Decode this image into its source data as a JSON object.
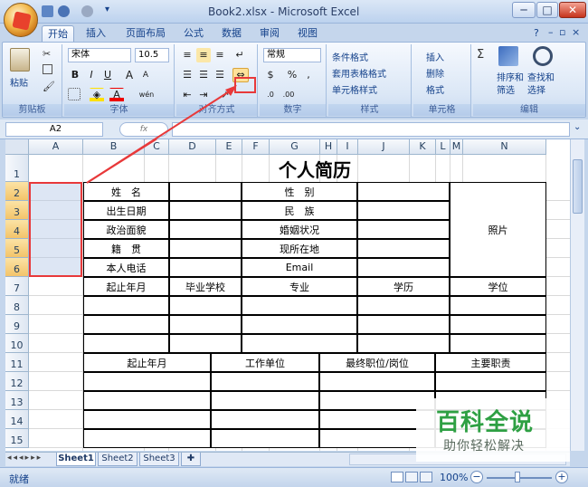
{
  "window": {
    "title": "Book2.xlsx - Microsoft Excel",
    "minimize": "─",
    "maximize": "□",
    "close": "✕"
  },
  "tabs": [
    "开始",
    "插入",
    "页面布局",
    "公式",
    "数据",
    "审阅",
    "视图"
  ],
  "ribbon": {
    "clipboard": {
      "paste": "粘贴",
      "label": "剪贴板"
    },
    "font": {
      "name": "宋体",
      "size": "10.5",
      "bold": "B",
      "italic": "I",
      "underline": "U",
      "grow": "A",
      "shrink": "A",
      "label": "字体",
      "phonetic": "wén"
    },
    "alignment": {
      "label": "对齐方式"
    },
    "number": {
      "format": "常规",
      "percent": "%",
      "comma": ",",
      "label": "数字"
    },
    "styles": {
      "cond": "条件格式",
      "table": "套用表格格式",
      "cell": "单元格样式",
      "label": "样式"
    },
    "cells": {
      "insert": "插入",
      "delete": "删除",
      "format": "格式",
      "label": "单元格"
    },
    "editing": {
      "sigma": "Σ",
      "sort": "排序和",
      "sort2": "筛选",
      "find": "查找和",
      "find2": "选择",
      "label": "编辑"
    }
  },
  "formula": {
    "namebox": "A2",
    "fx": "fx"
  },
  "columns": [
    "A",
    "B",
    "C",
    "D",
    "E",
    "F",
    "G",
    "H",
    "I",
    "J",
    "K",
    "L",
    "M",
    "N"
  ],
  "rows": [
    "1",
    "2",
    "3",
    "4",
    "5",
    "6",
    "7",
    "8",
    "9",
    "10",
    "11",
    "12",
    "13",
    "14",
    "15"
  ],
  "sheet": {
    "title": "个人简历",
    "r2": {
      "label": "姓　名",
      "b": "性　别"
    },
    "r3": {
      "label": "出生日期",
      "b": "民　族"
    },
    "r4": {
      "label": "政治面貌",
      "b": "婚姻状况",
      "photo": "照片"
    },
    "r5": {
      "label": "籍　贯",
      "b": "现所在地"
    },
    "r6": {
      "label": "本人电话",
      "b": "Email"
    },
    "r7": [
      "起止年月",
      "毕业学校",
      "专业",
      "学历",
      "学位"
    ],
    "r11": [
      "起止年月",
      "工作单位",
      "最终职位/岗位",
      "主要职责"
    ]
  },
  "sheettabs": [
    "Sheet1",
    "Sheet2",
    "Sheet3"
  ],
  "status": {
    "ready": "就绪",
    "zoom": "100%",
    "minus": "−",
    "plus": "+"
  },
  "watermark": {
    "title": "百科全说",
    "subtitle": "助你轻松解决"
  },
  "colors": {
    "accent": "#15428b",
    "highlight": "#e8393a",
    "watermark": "#2ea043"
  }
}
